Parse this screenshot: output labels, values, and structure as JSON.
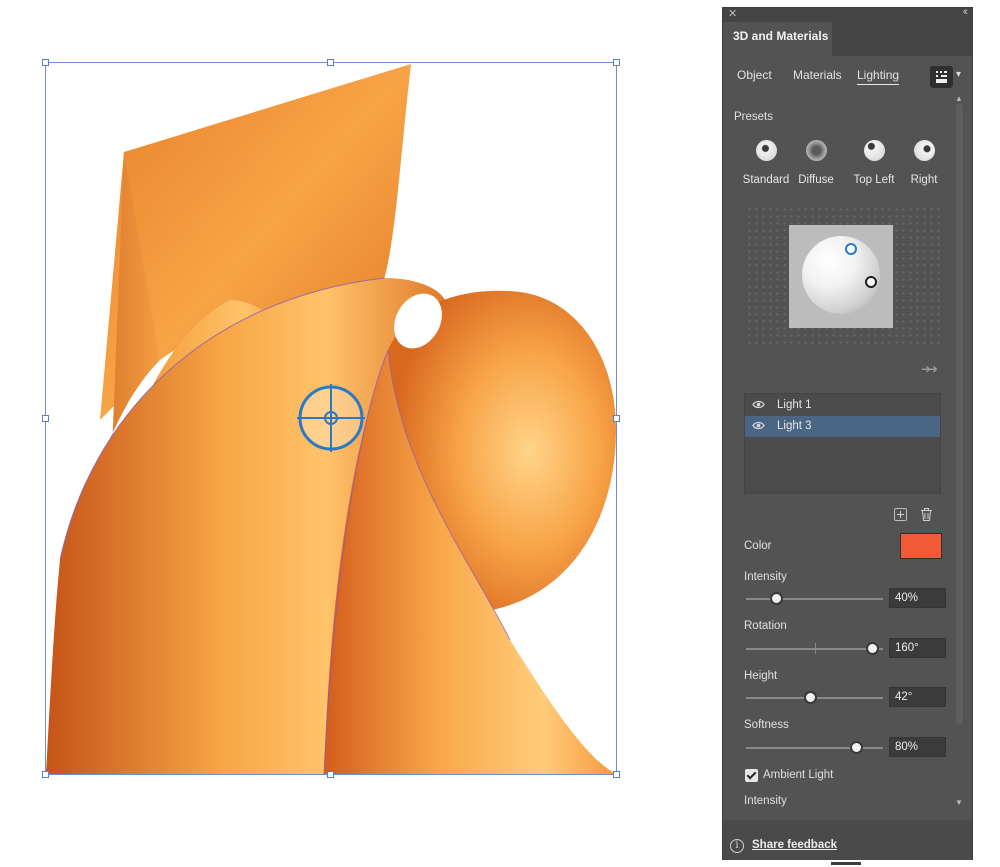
{
  "panel": {
    "title": "3D and Materials",
    "close_icon": "close-icon",
    "collapse_icon": "collapse-panel-icon",
    "tabs": [
      {
        "label": "Object",
        "active": false
      },
      {
        "label": "Materials",
        "active": false
      },
      {
        "label": "Lighting",
        "active": true
      }
    ],
    "render_button_icon": "render-settings-icon",
    "render_dropdown_icon": "chevron-down-icon",
    "presets": {
      "label": "Presets",
      "items": [
        {
          "label": "Standard",
          "icon": "preset-standard-icon"
        },
        {
          "label": "Diffuse",
          "icon": "preset-diffuse-icon"
        },
        {
          "label": "Top Left",
          "icon": "preset-top-left-icon"
        },
        {
          "label": "Right",
          "icon": "preset-right-icon"
        }
      ]
    },
    "lights": {
      "items": [
        {
          "label": "Light 1",
          "selected": false,
          "icon": "eye-icon"
        },
        {
          "label": "Light 3",
          "selected": true,
          "icon": "eye-icon"
        }
      ]
    },
    "color": {
      "label": "Color",
      "value": "#f05a35"
    },
    "intensity": {
      "label": "Intensity",
      "value": "40%",
      "fraction": 0.22
    },
    "rotation": {
      "label": "Rotation",
      "value": "160°",
      "fraction": 0.92
    },
    "height": {
      "label": "Height",
      "value": "42°",
      "fraction": 0.47
    },
    "softness": {
      "label": "Softness",
      "value": "80%",
      "fraction": 0.8
    },
    "ambient_light": {
      "label": "Ambient Light",
      "checked": true
    },
    "ambient_intensity": {
      "label": "Intensity"
    },
    "share_feedback": {
      "label": "Share feedback",
      "icon": "info-icon"
    }
  },
  "colors": {
    "panel_bg": "#535353",
    "selection": "#4b6584",
    "accent_blue": "#2b78c8",
    "object_orange": "#f39a3a"
  }
}
